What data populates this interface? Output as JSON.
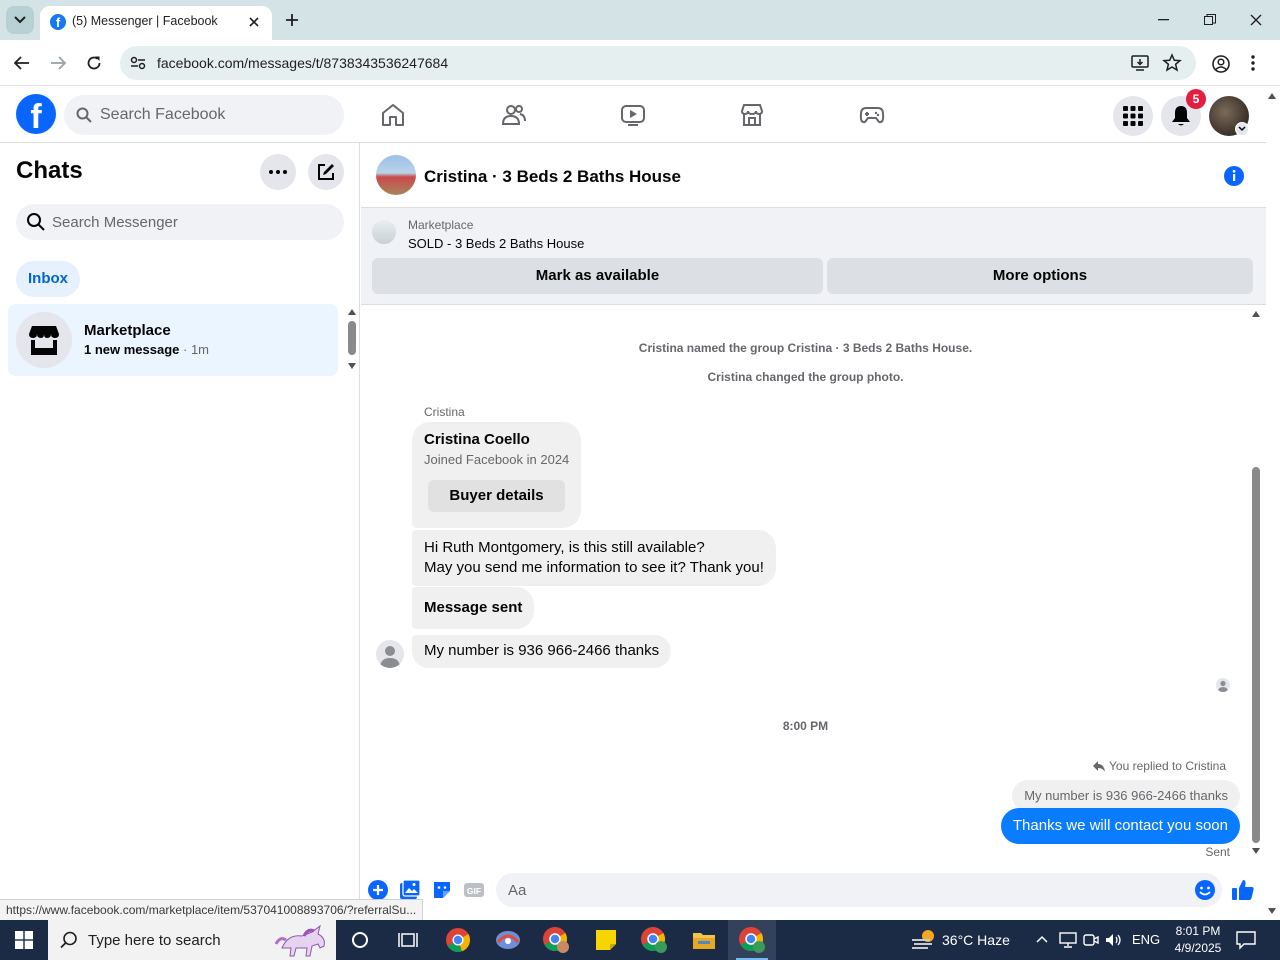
{
  "browser": {
    "tab_title": "(5) Messenger | Facebook",
    "url": "facebook.com/messages/t/8738343536247684",
    "status_url": "https://www.facebook.com/marketplace/item/537041008893706/?referralSu..."
  },
  "fb_header": {
    "search_placeholder": "Search Facebook",
    "notification_count": "5",
    "nav_icons": [
      "home-icon",
      "friends-icon",
      "video-icon",
      "marketplace-icon",
      "gaming-icon"
    ]
  },
  "chats": {
    "title": "Chats",
    "search_placeholder": "Search Messenger",
    "filter_label": "Inbox",
    "items": [
      {
        "name": "Marketplace",
        "preview": "1 new message",
        "time": " · 1m"
      }
    ]
  },
  "conversation": {
    "title": "Cristina · 3 Beds 2 Baths House",
    "marketplace_label": "Marketplace",
    "listing_title": "SOLD - 3 Beds 2 Baths House",
    "mark_available_label": "Mark as available",
    "more_options_label": "More options",
    "system_messages": [
      "Cristina named the group Cristina · 3 Beds 2 Baths House.",
      "Cristina changed the group photo."
    ],
    "sender_name": "Cristina",
    "buyer_card": {
      "name": "Cristina Coello",
      "joined": "Joined Facebook in 2024",
      "button_label": "Buyer details"
    },
    "incoming": [
      "Hi Ruth Montgomery, is this still available?",
      "May you send me information to see it? Thank you!",
      "Message sent",
      "My number is 936 966-2466 thanks"
    ],
    "time_separator": "8:00 PM",
    "replied_label": "You replied to Cristina",
    "quoted_text": "My number is 936 966-2466 thanks",
    "outgoing_text": "Thanks we will contact you soon",
    "sent_label": "Sent",
    "composer_placeholder": "Aa"
  },
  "taskbar": {
    "search_placeholder": "Type here to search",
    "weather": "36°C  Haze",
    "language": "ENG",
    "time": "8:01 PM",
    "date": "4/9/2025"
  },
  "colors": {
    "fb_blue": "#0866ff",
    "outgoing_bubble": "#0a7cff",
    "badge_red": "#e41e3f",
    "taskbar": "#1c2b45"
  }
}
